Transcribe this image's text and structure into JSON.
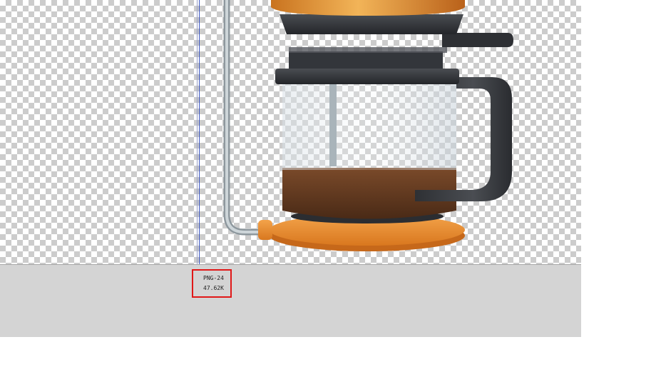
{
  "panels": {
    "optimized": {
      "format": "PNG-24",
      "file_size": "47.62K"
    }
  },
  "colors": {
    "highlight": "#e01818",
    "guide": "#3a55c0",
    "panel_bg": "#d4d4d4"
  }
}
